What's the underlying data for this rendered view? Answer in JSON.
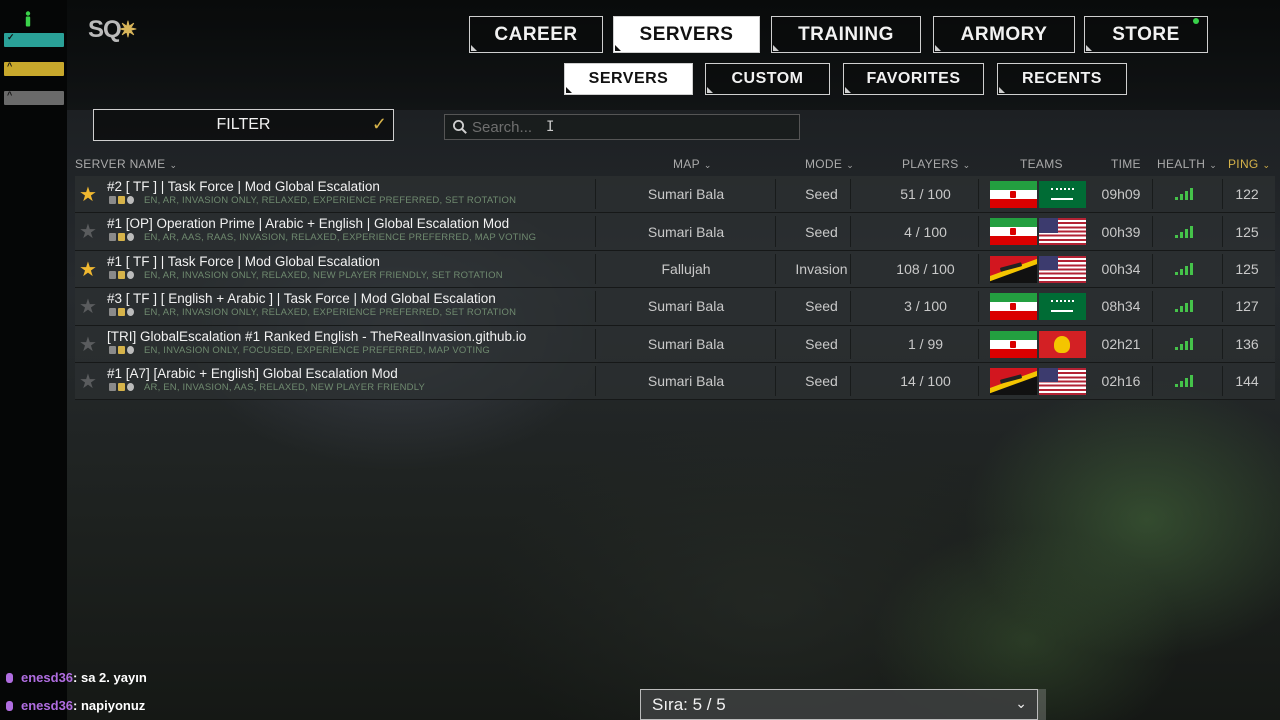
{
  "sidebar_overlay": {
    "bars": [
      {
        "label": "✓",
        "color": "#2aa198"
      },
      {
        "label": "^",
        "color": "#c8a82c"
      },
      {
        "label": "^",
        "color": "#6a6a6a"
      }
    ]
  },
  "logo": {
    "text": "SQ",
    "mark": "✷"
  },
  "nav": {
    "main_tabs": [
      {
        "label": "CAREER",
        "active": false
      },
      {
        "label": "SERVERS",
        "active": true
      },
      {
        "label": "TRAINING",
        "active": false
      },
      {
        "label": "ARMORY",
        "active": false
      },
      {
        "label": "STORE",
        "active": false,
        "notification": true
      }
    ],
    "sub_tabs": [
      {
        "label": "SERVERS",
        "active": true
      },
      {
        "label": "CUSTOM",
        "active": false
      },
      {
        "label": "FAVORITES",
        "active": false
      },
      {
        "label": "RECENTS",
        "active": false
      }
    ]
  },
  "filter": {
    "label": "FILTER",
    "check_icon": "✓"
  },
  "search": {
    "placeholder": "Search...",
    "value": "",
    "icon": "search-icon"
  },
  "table": {
    "columns": [
      {
        "label": "SERVER NAME",
        "sortable": true
      },
      {
        "label": "MAP",
        "sortable": true
      },
      {
        "label": "MODE",
        "sortable": true
      },
      {
        "label": "PLAYERS",
        "sortable": true
      },
      {
        "label": "TEAMS",
        "sortable": false
      },
      {
        "label": "TIME",
        "sortable": false
      },
      {
        "label": "HEALTH",
        "sortable": true
      },
      {
        "label": "PING",
        "sortable": true,
        "highlight_color": "#d6b34a"
      }
    ],
    "rows": [
      {
        "favorite": true,
        "name": "#2 [ TF ] | Task Force | Mod Global Escalation",
        "tags": "EN,  AR,  INVASION ONLY,  RELAXED,  EXPERIENCE PREFERRED,  SET ROTATION",
        "map": "Sumari Bala",
        "mode": "Seed",
        "players": "51 / 100",
        "teams": [
          "iran",
          "saudi"
        ],
        "time": "09h09",
        "health_bars": 3,
        "ping": "122"
      },
      {
        "favorite": false,
        "name": "#1 [OP] Operation Prime | Arabic + English | Global Escalation Mod",
        "tags": "EN,  AR,  AAS,  RAAS,  INVASION,  RELAXED,  EXPERIENCE PREFERRED,  MAP VOTING",
        "map": "Sumari Bala",
        "mode": "Seed",
        "players": "4 / 100",
        "teams": [
          "iran",
          "usa"
        ],
        "time": "00h39",
        "health_bars": 3,
        "ping": "125"
      },
      {
        "favorite": true,
        "name": "#1 [ TF ] | Task Force | Mod Global Escalation",
        "tags": "EN,  AR,  INVASION ONLY,  RELAXED,  NEW PLAYER FRIENDLY,  SET ROTATION",
        "map": "Fallujah",
        "mode": "Invasion",
        "players": "108 / 100",
        "teams": [
          "militia",
          "usa"
        ],
        "time": "00h34",
        "health_bars": 3,
        "ping": "125"
      },
      {
        "favorite": false,
        "name": "#3 [ TF ] [ English + Arabic ] | Task Force | Mod Global Escalation",
        "tags": "EN,  AR,  INVASION ONLY,  RELAXED,  EXPERIENCE PREFERRED,  SET ROTATION",
        "map": "Sumari Bala",
        "mode": "Seed",
        "players": "3 / 100",
        "teams": [
          "iran",
          "saudi"
        ],
        "time": "08h34",
        "health_bars": 3,
        "ping": "127"
      },
      {
        "favorite": false,
        "name": "[TRI] GlobalEscalation #1 Ranked English - TheRealInvasion.github.io",
        "tags": "EN,  INVASION ONLY,  FOCUSED,  EXPERIENCE PREFERRED,  MAP VOTING",
        "map": "Sumari Bala",
        "mode": "Seed",
        "players": "1 / 99",
        "teams": [
          "iran",
          "redmil"
        ],
        "time": "02h21",
        "health_bars": 3,
        "ping": "136"
      },
      {
        "favorite": false,
        "name": "#1 [A7] [Arabic + English] Global Escalation Mod",
        "tags": "AR,  EN,  INVASION,  AAS,  RELAXED,  NEW PLAYER FRIENDLY",
        "map": "Sumari Bala",
        "mode": "Seed",
        "players": "14 / 100",
        "teams": [
          "militia",
          "usa"
        ],
        "time": "02h16",
        "health_bars": 3,
        "ping": "144"
      }
    ]
  },
  "chat": [
    {
      "user": "enesd36",
      "message": ": sa 2. yayın"
    },
    {
      "user": "enesd36",
      "message": ": napiyonuz"
    }
  ],
  "queue": {
    "label": "Sıra: 5 / 5",
    "arrow": "⌄"
  },
  "colors": {
    "accent_gold": "#d6b34a",
    "health_green": "#45c34a",
    "chat_user": "#b06de0"
  }
}
